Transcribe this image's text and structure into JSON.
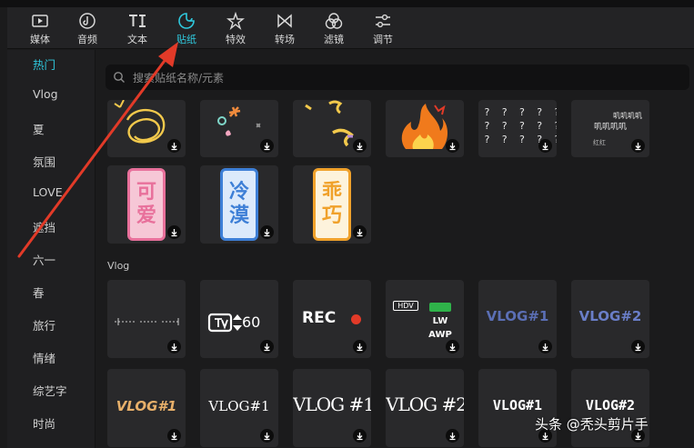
{
  "toolbar": {
    "items": [
      {
        "label": "媒体",
        "icon": "media-play-icon"
      },
      {
        "label": "音频",
        "icon": "audio-note-icon"
      },
      {
        "label": "文本",
        "icon": "text-ti-icon"
      },
      {
        "label": "贴纸",
        "icon": "sticker-icon",
        "active": true
      },
      {
        "label": "特效",
        "icon": "effects-star-icon"
      },
      {
        "label": "转场",
        "icon": "transition-bowtie-icon"
      },
      {
        "label": "滤镜",
        "icon": "filter-circles-icon"
      },
      {
        "label": "调节",
        "icon": "adjust-sliders-icon"
      }
    ]
  },
  "sidebar": {
    "items": [
      {
        "label": "热门",
        "active": true
      },
      {
        "label": "Vlog"
      },
      {
        "label": "夏"
      },
      {
        "label": "氛围"
      },
      {
        "label": "LOVE"
      },
      {
        "label": "遮挡"
      },
      {
        "label": "六一"
      },
      {
        "label": "春"
      },
      {
        "label": "旅行"
      },
      {
        "label": "情绪"
      },
      {
        "label": "综艺字"
      },
      {
        "label": "时尚"
      }
    ]
  },
  "search": {
    "placeholder": "搜索贴纸名称/元素"
  },
  "hot": {
    "badges": [
      {
        "text": [
          "可",
          "爱"
        ],
        "color": "#e8709b",
        "bg": "#f6c7d6"
      },
      {
        "text": [
          "冷",
          "漠"
        ],
        "color": "#3d7fd6",
        "bg": "#dceafb"
      },
      {
        "text": [
          "乖",
          "巧"
        ],
        "color": "#f0a12a",
        "bg": "#fdf3dc"
      }
    ],
    "text_tile": {
      "lines": [
        "叽叽叽叽",
        "叽叽叽叽",
        "红红"
      ]
    },
    "question_marks": "? ? ? ? ? ?"
  },
  "vlog_section": {
    "label": "Vlog",
    "row1": {
      "tile2_text": "60",
      "tile3_text": "REC",
      "tile4_texts": [
        "HDV",
        "LW",
        "AWP"
      ],
      "tile5_text": "VLOG#1",
      "tile6_text": "VLOG#2"
    },
    "row2": {
      "tile1_text": "VLOG#1",
      "tile2_text": "VLOG#1",
      "tile3_text": "VLOG #1",
      "tile4_text": "VLOG #2",
      "tile5_text": "VLOG#1",
      "tile6_text": "VLOG#2"
    }
  },
  "colors": {
    "accent": "#2fc9de",
    "annotation_arrow": "#e23a28"
  },
  "watermark": "头条 @秃头剪片手"
}
